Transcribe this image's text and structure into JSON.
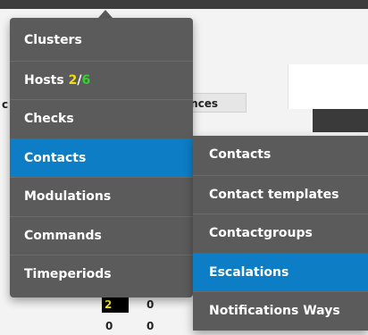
{
  "background": {
    "header_cell": "ences",
    "left_char": "c",
    "cells": {
      "a": "2",
      "b": "0",
      "c": "0",
      "d": "0"
    }
  },
  "menu": {
    "items": [
      {
        "label": "Clusters"
      },
      {
        "label": "Hosts",
        "count_primary": "2",
        "count_sep": "/",
        "count_secondary": "6"
      },
      {
        "label": "Checks"
      },
      {
        "label": "Contacts"
      },
      {
        "label": "Modulations"
      },
      {
        "label": "Commands"
      },
      {
        "label": "Timeperiods"
      }
    ],
    "active": "Contacts"
  },
  "submenu": {
    "items": [
      {
        "label": "Contacts"
      },
      {
        "label": "Contact templates"
      },
      {
        "label": "Contactgroups"
      },
      {
        "label": "Escalations"
      },
      {
        "label": "Notifications Ways"
      }
    ],
    "active": "Escalations"
  },
  "colors": {
    "menu_bg": "#5b5b5b",
    "active": "#0d7dc5",
    "count_yellow": "#f2dc1a",
    "count_green": "#32d32e"
  }
}
